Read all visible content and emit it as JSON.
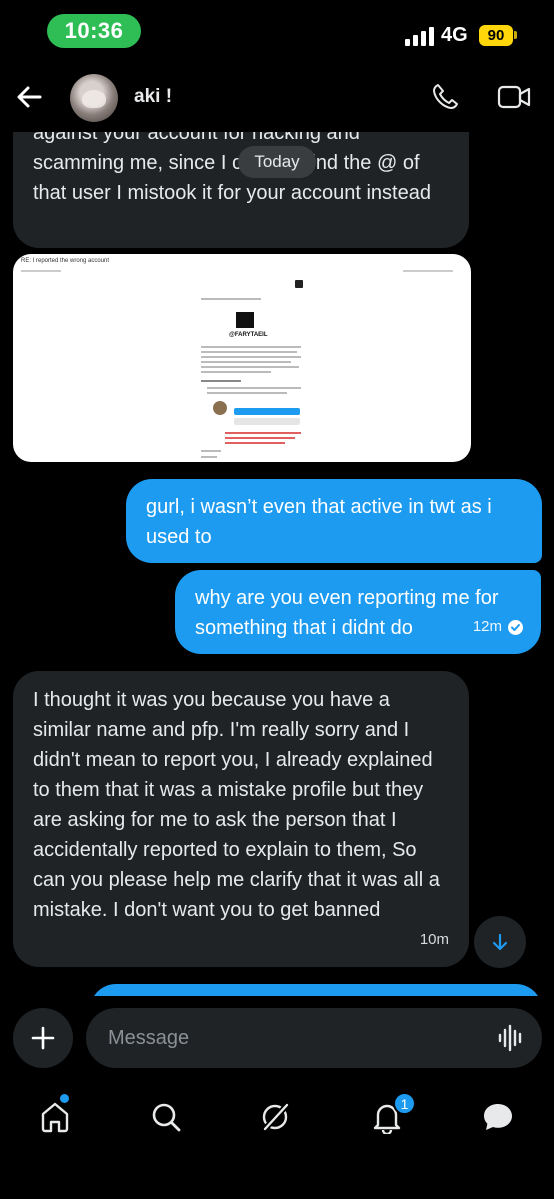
{
  "status_bar": {
    "time": "10:36",
    "network": "4G",
    "battery": "90"
  },
  "header": {
    "contact_name": "aki !"
  },
  "date_divider": "Today",
  "messages": [
    {
      "direction": "incoming",
      "text": "against your account for hacking and scamming me, since I couldn't find the @ of that user I mistook it for your account instead"
    },
    {
      "direction": "incoming",
      "type": "image",
      "image_title": "RE: I reported the wrong account",
      "image_handle": "@FARYTAEIL"
    },
    {
      "direction": "outgoing",
      "text": "gurl, i wasn’t even that active in twt as i used to"
    },
    {
      "direction": "outgoing",
      "text": "why are you even reporting me for something that i didnt do",
      "time": "12m"
    },
    {
      "direction": "incoming",
      "text": "I thought it was you because you have a similar name and pfp. I'm really sorry and I didn't mean to report you, I already explained to them that it was a mistake profile but they are asking for me to ask the person that I accidentally reported to explain to them, So can you please help me clarify that it was all a mistake. I don't want you to get banned",
      "time": "10m"
    }
  ],
  "composer": {
    "placeholder": "Message"
  },
  "bottom_nav": {
    "notifications_count": "1"
  },
  "colors": {
    "accent": "#1d9bf0",
    "incoming_bubble": "#1f2326",
    "time_pill": "#2fbe55",
    "battery": "#ffd60a"
  }
}
